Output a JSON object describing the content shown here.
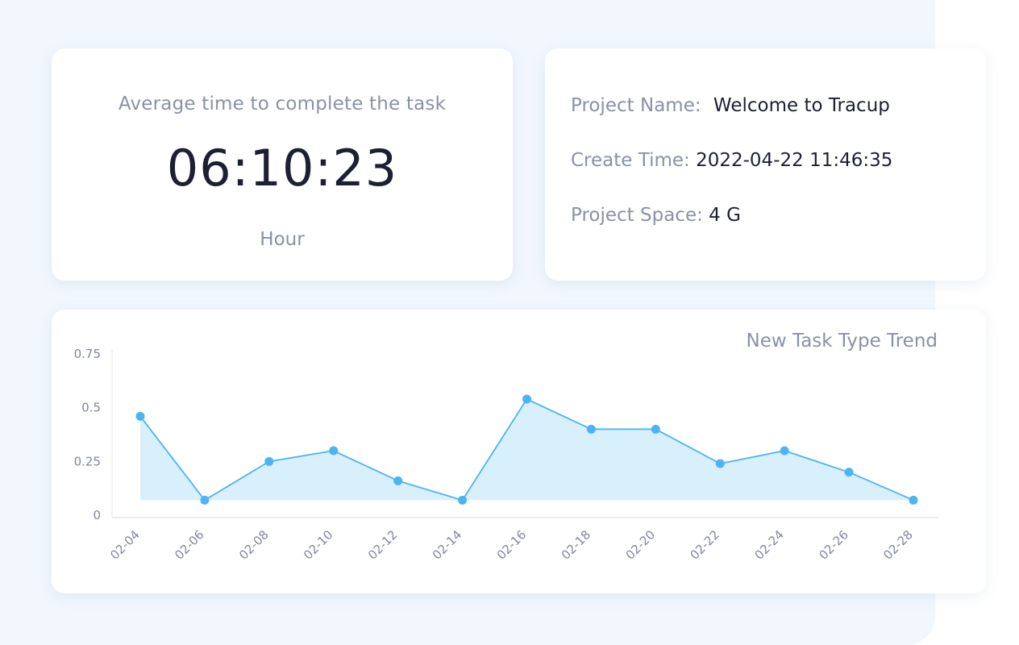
{
  "average_card": {
    "title": "Average time to complete the task",
    "value": "06:10:23",
    "unit": "Hour"
  },
  "project_info": {
    "name_label": "Project Name:",
    "name_value": "Welcome to Tracup",
    "create_time_label": "Create Time:",
    "create_time_value": "2022-04-22 11:46:35",
    "space_label": "Project Space:",
    "space_value": "4 G"
  },
  "colors": {
    "accent": "#4bb4f4",
    "area_fill": "#d8effc",
    "text_dark": "#1d2033",
    "text_muted": "#8a91a6",
    "backdrop": "#f1f7fd"
  },
  "chart_data": {
    "type": "area",
    "title": "New Task Type Trend",
    "categories": [
      "02-04",
      "02-06",
      "02-08",
      "02-10",
      "02-12",
      "02-14",
      "02-16",
      "02-18",
      "02-20",
      "02-22",
      "02-24",
      "02-26",
      "02-28"
    ],
    "series": [
      {
        "values": [
          0.46,
          0.07,
          0.25,
          0.3,
          0.16,
          0.07,
          0.54,
          0.4,
          0.4,
          0.24,
          0.3,
          0.2,
          0.07
        ]
      }
    ],
    "y_ticks": [
      "0",
      "0.25",
      "0.5",
      "0.75"
    ],
    "ylim": [
      0,
      0.75
    ],
    "grid": false,
    "legend": "none"
  }
}
